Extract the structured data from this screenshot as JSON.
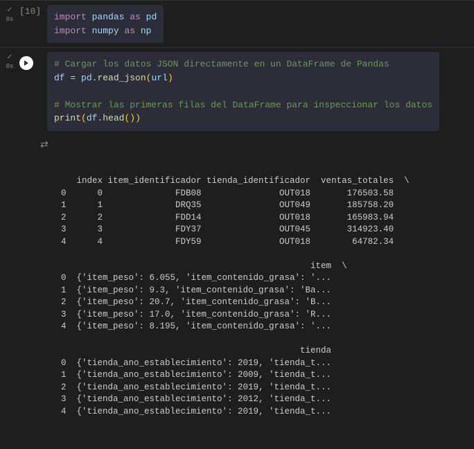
{
  "cell1": {
    "prompt": "[10]",
    "timing": "0s",
    "code_line1": {
      "kw1": "import",
      "mod1": "pandas",
      "kw2": "as",
      "alias1": "pd"
    },
    "code_line2": {
      "kw1": "import",
      "mod1": "numpy",
      "kw2": "as",
      "alias1": "np"
    }
  },
  "cell2": {
    "timing": "0s",
    "comment1": "# Cargar los datos JSON directamente en un DataFrame de Pandas",
    "line2_lhs": "df",
    "line2_eq": " = ",
    "line2_obj": "pd",
    "line2_func": "read_json",
    "line2_arg": "url",
    "comment2": "# Mostrar las primeras filas del DataFrame para inspeccionar los datos",
    "line4_func": "print",
    "line4_obj": "df",
    "line4_method": "head"
  },
  "output": {
    "header1": "   index item_identificador tienda_identificador  ventas_totales  \\",
    "rows1": [
      "0      0              FDB08               OUT018       176503.58",
      "1      1              DRQ35               OUT049       185758.20",
      "2      2              FDD14               OUT018       165983.94",
      "3      3              FDY37               OUT045       314923.40",
      "4      4              FDY59               OUT018        64782.34"
    ],
    "header2": "                                                item  \\",
    "rows2": [
      "0  {'item_peso': 6.055, 'item_contenido_grasa': '...",
      "1  {'item_peso': 9.3, 'item_contenido_grasa': 'Ba...",
      "2  {'item_peso': 20.7, 'item_contenido_grasa': 'B...",
      "3  {'item_peso': 17.0, 'item_contenido_grasa': 'R...",
      "4  {'item_peso': 8.195, 'item_contenido_grasa': '..."
    ],
    "header3": "                                              tienda",
    "rows3": [
      "0  {'tienda_ano_establecimiento': 2019, 'tienda_t...",
      "1  {'tienda_ano_establecimiento': 2009, 'tienda_t...",
      "2  {'tienda_ano_establecimiento': 2019, 'tienda_t...",
      "3  {'tienda_ano_establecimiento': 2012, 'tienda_t...",
      "4  {'tienda_ano_establecimiento': 2019, 'tienda_t..."
    ]
  }
}
